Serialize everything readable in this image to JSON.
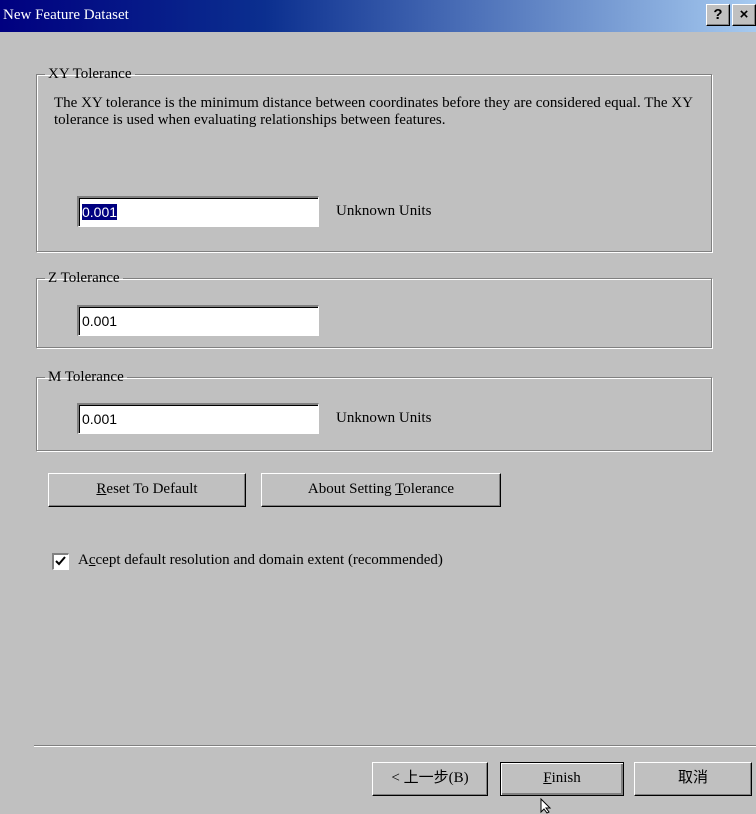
{
  "window": {
    "title": "New Feature Dataset",
    "help_label": "?",
    "close_label": "×"
  },
  "xy_tolerance": {
    "legend": "XY Tolerance",
    "description": "The XY tolerance is the minimum distance between coordinates before they are considered equal. The XY tolerance is used when evaluating relationships between features.",
    "value": "0.001",
    "units": "Unknown Units"
  },
  "z_tolerance": {
    "legend": "Z Tolerance",
    "value": "0.001"
  },
  "m_tolerance": {
    "legend": "M Tolerance",
    "value": "0.001",
    "units": "Unknown Units"
  },
  "buttons": {
    "reset_prefix": "",
    "reset_mnemonic": "R",
    "reset_suffix": "eset To Default",
    "about_prefix": "About Setting ",
    "about_mnemonic": "T",
    "about_suffix": "olerance"
  },
  "accept_default": {
    "checked": true,
    "label_prefix": "A",
    "label_mnemonic": "c",
    "label_suffix": "cept default resolution and domain extent (recommended)"
  },
  "footer": {
    "back_label": "< 上一步(B)",
    "finish_mnemonic": "F",
    "finish_suffix": "inish",
    "cancel_label": "取消"
  }
}
